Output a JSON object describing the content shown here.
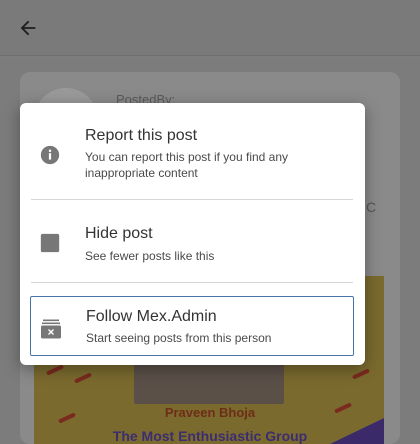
{
  "background": {
    "posted_by_label": "PostedBy:",
    "stray_char": "C",
    "banner": {
      "name": "Praveen Bhoja",
      "group": "The Most Enthusiastic Group"
    }
  },
  "dialog": {
    "options": [
      {
        "title": "Report this post",
        "subtitle": "You can report this post if you find any inappropriate content",
        "icon": "info-icon"
      },
      {
        "title": "Hide post",
        "subtitle": "See fewer posts like this",
        "icon": "hide-square-icon"
      },
      {
        "title": "Follow Mex.Admin",
        "subtitle": "Start seeing posts from this person",
        "icon": "follow-inbox-icon"
      }
    ]
  },
  "colors": {
    "dialog_bg": "#ffffff",
    "scrim": "#7e7e7e",
    "focus_border": "#4a74a8",
    "icon_gray": "#777777"
  }
}
